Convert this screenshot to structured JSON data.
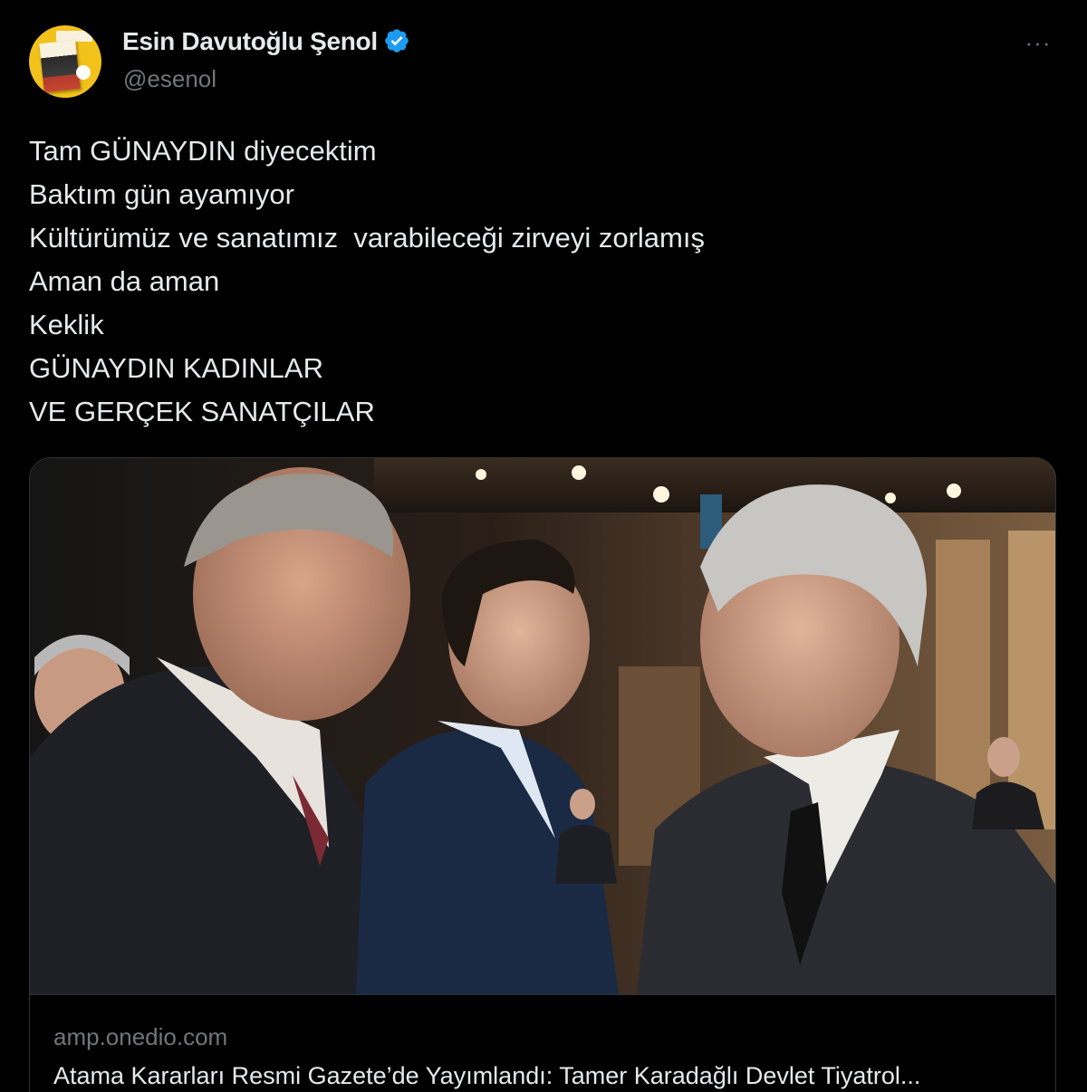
{
  "author": {
    "display_name": "Esin Davutoğlu Şenol",
    "handle": "@esenol",
    "verified": true,
    "avatar_icon": "book-cover-avatar"
  },
  "menu": {
    "more_label": "···"
  },
  "tweet": {
    "lines": [
      "Tam GÜNAYDIN diyecektim",
      "Baktım gün ayamıyor",
      "Kültürümüz ve sanatımız  varabileceği zirveyi zorlamış",
      "Aman da aman",
      "Keklik",
      "GÜNAYDIN KADINLAR",
      "VE GERÇEK SANATÇILAR"
    ]
  },
  "link_card": {
    "domain": "amp.onedio.com",
    "title": "Atama Kararları Resmi Gazete’de Yayımlandı: Tamer Karadağlı Devlet Tiyatrol..."
  },
  "colors": {
    "background": "#000000",
    "text_primary": "#e7e9ea",
    "text_secondary": "#71767b",
    "border": "#2f3336",
    "verified_badge": "#1d9bf0"
  }
}
